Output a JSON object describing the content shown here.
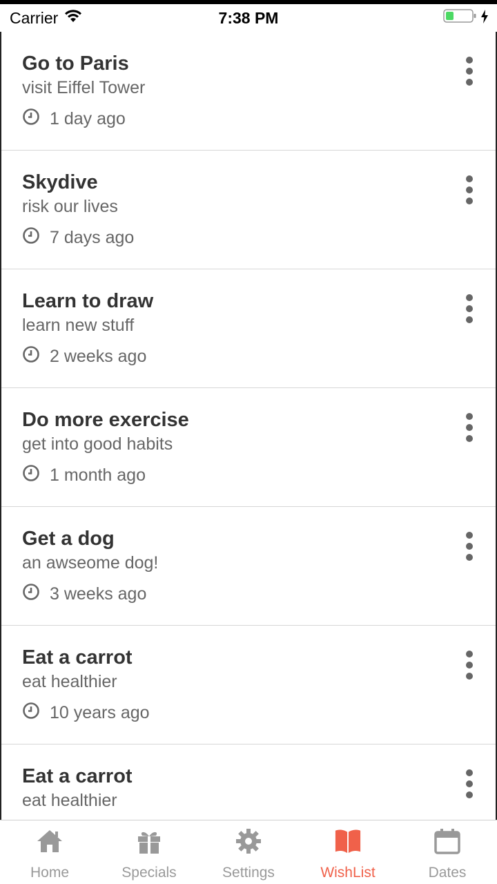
{
  "status_bar": {
    "carrier": "Carrier",
    "time": "7:38 PM"
  },
  "wishlist": [
    {
      "title": "Go to Paris",
      "subtitle": "visit Eiffel Tower",
      "time": "1 day ago"
    },
    {
      "title": "Skydive",
      "subtitle": "risk our lives",
      "time": "7 days ago"
    },
    {
      "title": "Learn to draw",
      "subtitle": "learn new stuff",
      "time": "2 weeks ago"
    },
    {
      "title": "Do more exercise",
      "subtitle": "get into good habits",
      "time": "1 month ago"
    },
    {
      "title": "Get a dog",
      "subtitle": "an awseome dog!",
      "time": "3 weeks ago"
    },
    {
      "title": "Eat a carrot",
      "subtitle": "eat healthier",
      "time": "10 years ago"
    },
    {
      "title": "Eat a carrot",
      "subtitle": "eat healthier",
      "time": ""
    }
  ],
  "tabs": [
    {
      "label": "Home",
      "icon": "home-icon"
    },
    {
      "label": "Specials",
      "icon": "gift-icon"
    },
    {
      "label": "Settings",
      "icon": "gear-icon"
    },
    {
      "label": "WishList",
      "icon": "book-icon",
      "active": true
    },
    {
      "label": "Dates",
      "icon": "calendar-icon"
    }
  ],
  "colors": {
    "accent": "#f0614a",
    "inactive": "#999999",
    "battery": "#4cd964"
  }
}
